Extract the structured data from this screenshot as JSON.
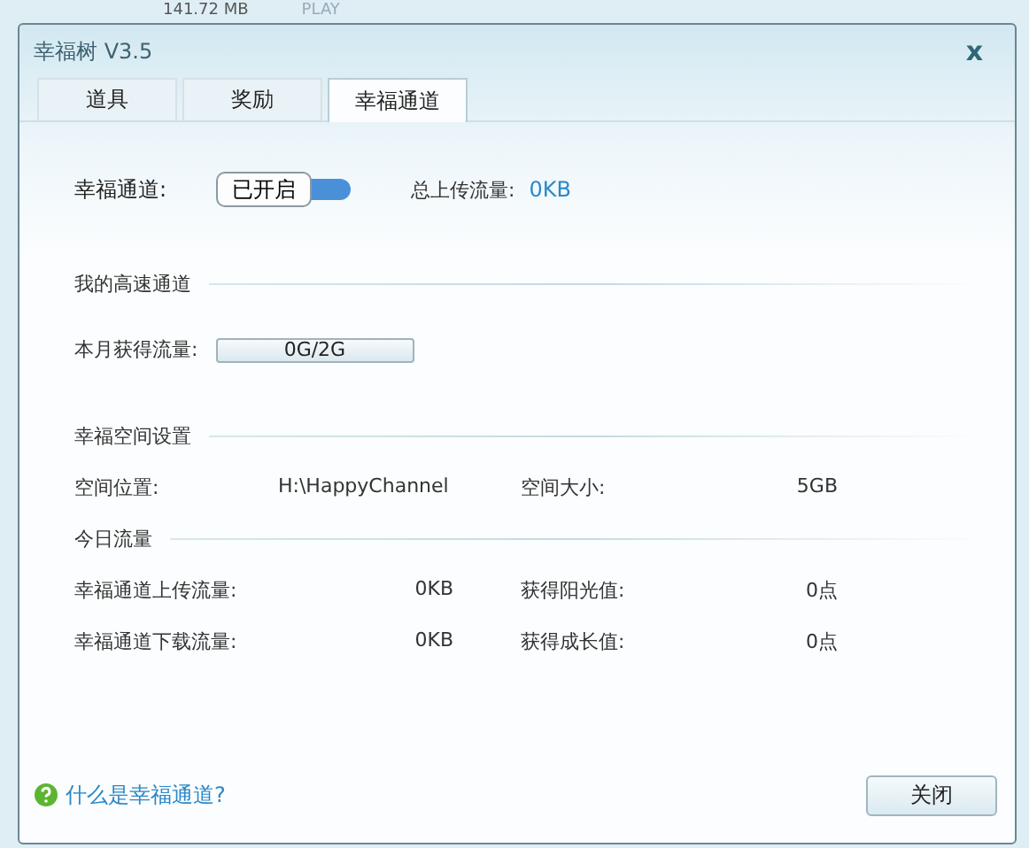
{
  "background_row": {
    "size": "141.72 MB",
    "play_label": "PLAY"
  },
  "window": {
    "title": "幸福树 V3.5",
    "close": "x"
  },
  "tabs": [
    {
      "label": "道具",
      "selected": false
    },
    {
      "label": "奖励",
      "selected": false
    },
    {
      "label": "幸福通道",
      "selected": true
    }
  ],
  "channel": {
    "label": "幸福通道:",
    "toggle": {
      "label": "已开启",
      "on": true
    },
    "upload_label": "总上传流量:",
    "upload_value": "0KB"
  },
  "fast_channel": {
    "heading": "我的高速通道",
    "label": "本月获得流量:",
    "progress": {
      "text": "0G/2G",
      "level": 0
    }
  },
  "space": {
    "heading": "幸福空间设置",
    "location_label": "空间位置:",
    "location_value": "H:\\HappyChannel",
    "size_label": "空间大小:",
    "size_value": "5GB"
  },
  "today": {
    "heading": "今日流量",
    "rows": [
      {
        "label": "幸福通道上传流量:",
        "value": "0KB",
        "label_2": "获得阳光值:",
        "value_2": "0点"
      },
      {
        "label": "幸福通道下载流量:",
        "value": "0KB",
        "label_2": "获得成长值:",
        "value_2": "0点"
      }
    ]
  },
  "footer": {
    "help_link": "什么是幸福通道?",
    "close_button": "关闭"
  }
}
